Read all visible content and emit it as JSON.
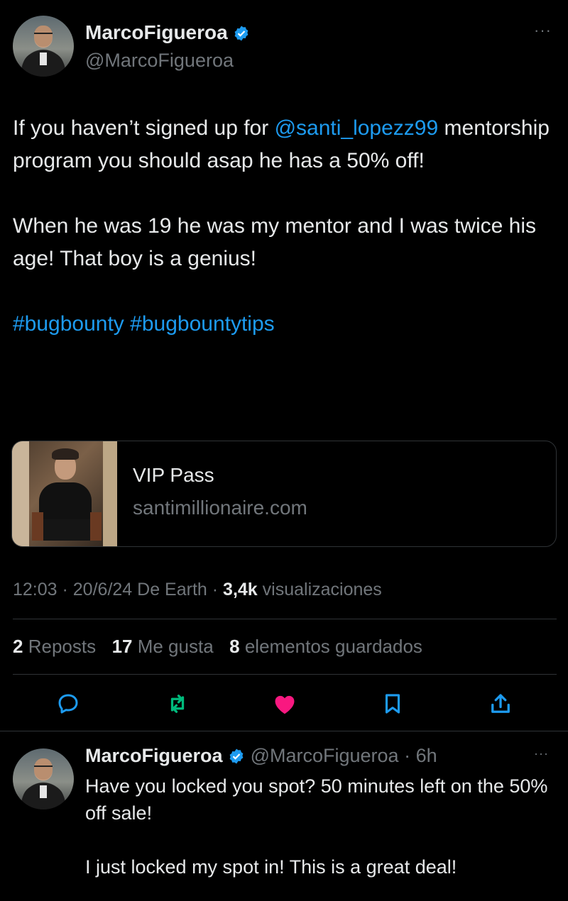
{
  "tweet": {
    "author": {
      "name": "MarcoFigueroa",
      "handle": "@MarcoFigueroa"
    },
    "paragraphs": [
      {
        "parts": [
          {
            "t": "If you haven’t signed up for ",
            "link": false
          },
          {
            "t": "@santi_lopezz99",
            "link": true
          },
          {
            "t": " mentorship program you should asap he has a 50% off!",
            "link": false
          }
        ]
      },
      {
        "parts": [
          {
            "t": "When he was 19 he was my mentor and I was twice his age! That boy is a genius!",
            "link": false
          }
        ]
      },
      {
        "parts": [
          {
            "t": "#bugbounty",
            "link": true
          },
          {
            "t": " ",
            "link": false
          },
          {
            "t": "#bugbountytips",
            "link": true
          }
        ]
      }
    ],
    "card": {
      "title": "VIP Pass",
      "domain": "santimillionaire.com"
    },
    "meta": {
      "time": "12:03",
      "date": "20/6/24",
      "source": "De Earth",
      "views_count": "3,4k",
      "views_label": "visualizaciones"
    },
    "stats": {
      "reposts_count": "2",
      "reposts_label": "Reposts",
      "likes_count": "17",
      "likes_label": "Me gusta",
      "bookmarks_count": "8",
      "bookmarks_label": "elementos guardados"
    },
    "actions": [
      "reply-icon",
      "repost-icon",
      "like-icon",
      "bookmark-icon",
      "share-icon"
    ]
  },
  "reply": {
    "author": {
      "name": "MarcoFigueroa",
      "handle": "@MarcoFigueroa"
    },
    "time": "6h",
    "lines": [
      "Have you locked you spot? 50 minutes left on the 50% off sale!",
      "I just locked my spot in! This is a great deal!"
    ]
  },
  "colors": {
    "accent": "#1d9bf0",
    "repost": "#00ba7c",
    "like": "#f91880",
    "muted": "#71767b",
    "border": "#2f3336"
  }
}
